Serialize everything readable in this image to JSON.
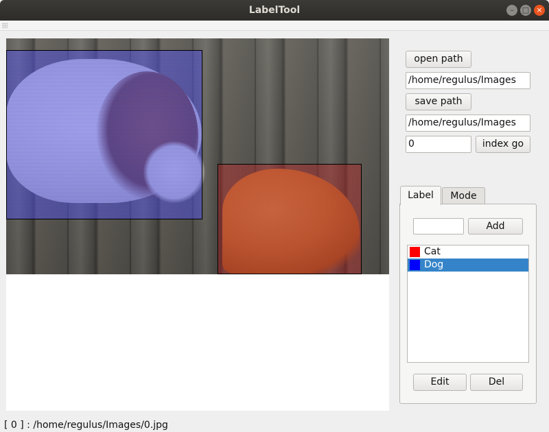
{
  "window": {
    "title": "LabelTool",
    "controls": {
      "minimize": "–",
      "maximize": "□",
      "close": "×"
    }
  },
  "controls": {
    "open_path_label": "open path",
    "open_path_value": "/home/regulus/Images",
    "save_path_label": "save path",
    "save_path_value": "/home/regulus/Images",
    "index_value": "0",
    "index_go_label": "index go"
  },
  "tabs": [
    {
      "label": "Label",
      "active": true
    },
    {
      "label": "Mode",
      "active": false
    }
  ],
  "label_panel": {
    "new_label_value": "",
    "add_label": "Add",
    "items": [
      {
        "label": "Cat",
        "color": "#ff0000",
        "selected": false
      },
      {
        "label": "Dog",
        "color": "#0000ff",
        "selected": true
      }
    ],
    "edit_label": "Edit",
    "del_label": "Del"
  },
  "annotations": [
    {
      "label": "Dog",
      "color": "#4646e6"
    },
    {
      "label": "Cat",
      "color": "#c82828"
    }
  ],
  "status": {
    "text": "[ 0 ] : /home/regulus/Images/0.jpg"
  }
}
